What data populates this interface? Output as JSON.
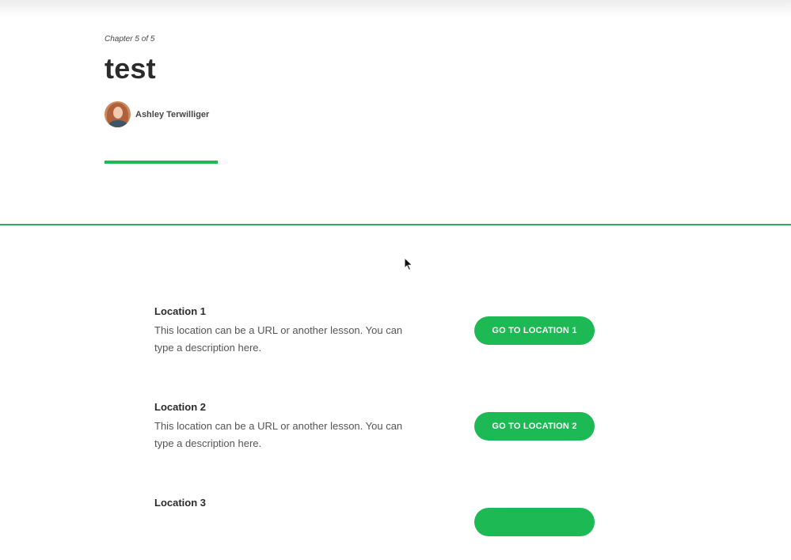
{
  "header": {
    "chapter_label": "Chapter 5 of 5",
    "title": "test",
    "author": {
      "name": "Ashley Terwilliger",
      "avatar_icon": "author-avatar"
    }
  },
  "colors": {
    "accent": "#1db954",
    "divider": "#27ae60",
    "text": "#2b2b2b"
  },
  "locations": [
    {
      "title": "Location 1",
      "description": "This location can be a URL or another lesson. You can type a description here.",
      "button_label": "GO TO LOCATION 1"
    },
    {
      "title": "Location 2",
      "description": "This location can be a URL or another lesson. You can type a description here.",
      "button_label": "GO TO LOCATION 2"
    },
    {
      "title": "Location 3",
      "description": "",
      "button_label": ""
    }
  ]
}
